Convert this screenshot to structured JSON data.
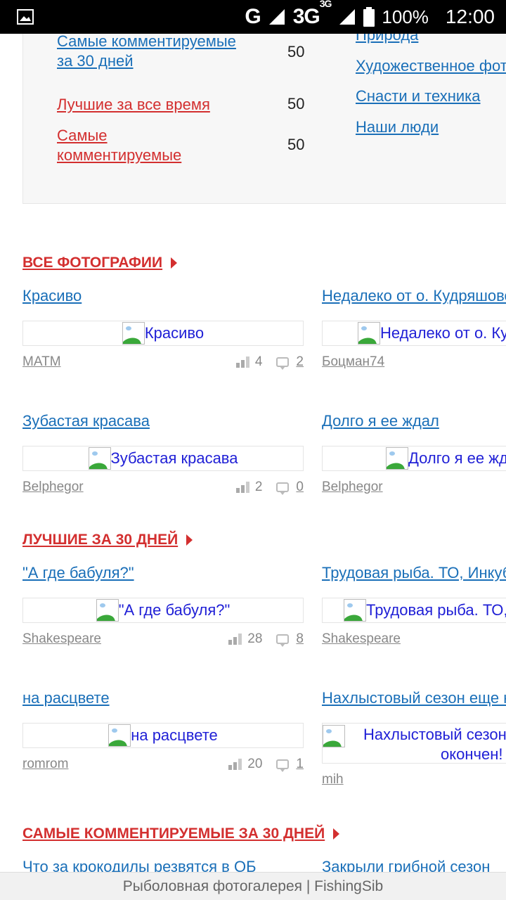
{
  "status_bar": {
    "network": "G",
    "network2": "3G",
    "network2_sup": "3G",
    "battery": "100%",
    "time": "12:00"
  },
  "ratings": [
    {
      "label": "Самые комментируемые за 30 дней",
      "count": "50",
      "color": "blue"
    },
    {
      "label": "Лучшие за все время",
      "count": "50",
      "color": "red"
    },
    {
      "label": "Самые комментируемые",
      "count": "50",
      "color": "red"
    }
  ],
  "categories": [
    "Природа",
    "Художественное фото",
    "Снасти и техника",
    "Наши люди"
  ],
  "sections": {
    "all_photos": "ВСЕ ФОТОГРАФИИ",
    "best_30": "ЛУЧШИЕ ЗА 30 ДНЕЙ",
    "most_commented_30": "САМЫЕ КОММЕНТИРУЕМЫЕ ЗА 30 ДНЕЙ"
  },
  "photos": [
    {
      "title": "Красиво",
      "alt": "Красиво",
      "author": "MATM",
      "views": "4",
      "comments": "2"
    },
    {
      "title": "Недалеко от о. Кудряшовский",
      "alt": "Недалеко от о. Кудряшовский",
      "author": "Боцман74"
    },
    {
      "title": "Зубастая красава",
      "alt": "Зубастая красава",
      "author": "Belphegor",
      "views": "2",
      "comments": "0"
    },
    {
      "title": "Долго я ее ждал",
      "alt": "Долго я ее ждал",
      "author": "Belphegor"
    },
    {
      "title": "\"А где бабуля?\"",
      "alt": "\"А где бабуля?\"",
      "author": "Shakespeare",
      "views": "28",
      "comments": "8"
    },
    {
      "title": "Трудовая рыба. ТО, Инкубатор",
      "alt": "Трудовая рыба. ТО, Инкубатор",
      "author": "Shakespeare"
    },
    {
      "title": "на расцвете",
      "alt": "на расцвете",
      "author": "romrom",
      "views": "20",
      "comments": "1"
    },
    {
      "title": "Нахлыстовый сезон еще не окончен",
      "alt_line1": "Нахлыстовый сезон еще не",
      "alt_line2": "окончен!",
      "author": "mih"
    }
  ],
  "cut_links": [
    "Что за крокодилы резвятся в ОБ",
    "Закрыли грибной сезон"
  ],
  "page_title": "Рыболовная фотогалерея | FishingSib"
}
